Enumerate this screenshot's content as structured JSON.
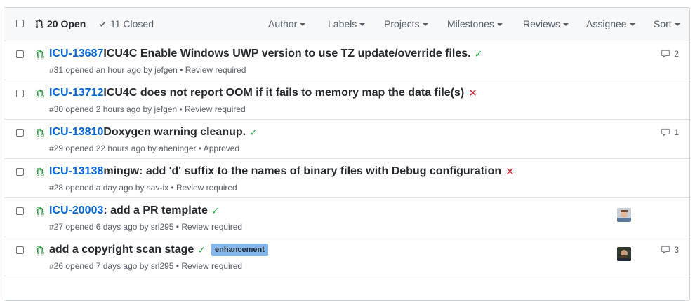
{
  "header": {
    "open_label": "20 Open",
    "closed_label": "11 Closed",
    "filters": [
      "Author",
      "Labels",
      "Projects",
      "Milestones",
      "Reviews",
      "Assignee",
      "Sort"
    ]
  },
  "rows": [
    {
      "ticket": "ICU-13687",
      "title": " ICU4C Enable Windows UWP version to use TZ update/override files.",
      "status": "success",
      "meta": "#31 opened an hour ago by jefgen • Review required",
      "comments": "2"
    },
    {
      "ticket": "ICU-13712",
      "title": " ICU4C does not report OOM if it fails to memory map the data file(s)",
      "status": "failure",
      "meta": "#30 opened 2 hours ago by jefgen • Review required"
    },
    {
      "ticket": "ICU-13810",
      "title": " Doxygen warning cleanup.",
      "status": "success",
      "meta": "#29 opened 22 hours ago by aheninger • Approved",
      "comments": "1"
    },
    {
      "ticket": "ICU-13138",
      "title": " mingw: add 'd' suffix to the names of binary files with Debug configuration",
      "status": "failure",
      "meta": "#28 opened a day ago by sav-ix • Review required"
    },
    {
      "ticket": "ICU-20003",
      "title": " : add a PR template",
      "status": "success",
      "meta": "#27 opened 6 days ago by srl295 • Review required",
      "avatar": true
    },
    {
      "ticket": "",
      "title": "add a copyright scan stage",
      "status": "success",
      "label": "enhancement",
      "meta": "#26 opened 7 days ago by srl295 • Review required",
      "avatar": true,
      "comments": "3"
    }
  ],
  "colors": {
    "link": "#0366d6",
    "success": "#28a745",
    "failure": "#cb2431",
    "label_enhancement": "#84b6eb"
  }
}
